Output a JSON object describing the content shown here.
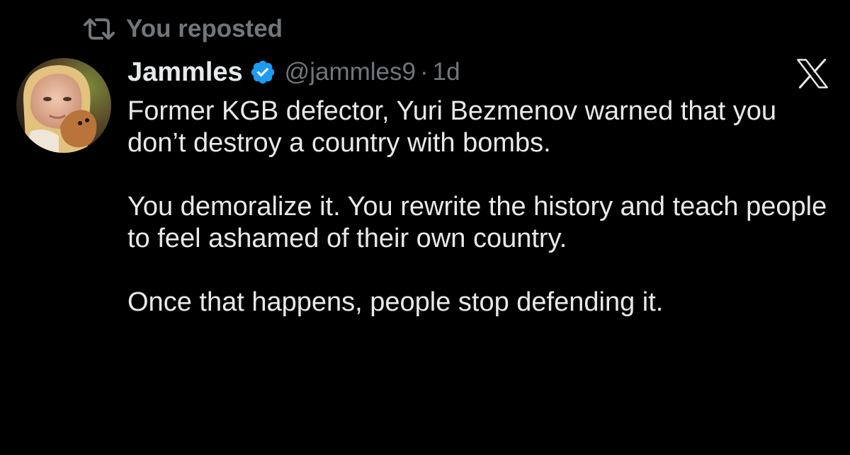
{
  "repost": {
    "icon": "repost-icon",
    "label": "You reposted"
  },
  "tweet": {
    "author_name": "Jammles",
    "verified_icon": "verified-badge-icon",
    "handle": "@jammles9",
    "separator": "·",
    "time": "1d",
    "paragraphs": [
      "Former KGB defector, Yuri Bezmenov warned that you don’t destroy a country with bombs.",
      "You demoralize it. You rewrite the history and teach people to feel ashamed of their own country.",
      "Once that happens, people stop defending it."
    ]
  },
  "brand": {
    "logo_icon": "x-logo-icon"
  },
  "colors": {
    "background": "#000000",
    "text_primary": "#e7e9ea",
    "text_secondary": "#71767b",
    "verified_blue": "#1d9bf0"
  }
}
